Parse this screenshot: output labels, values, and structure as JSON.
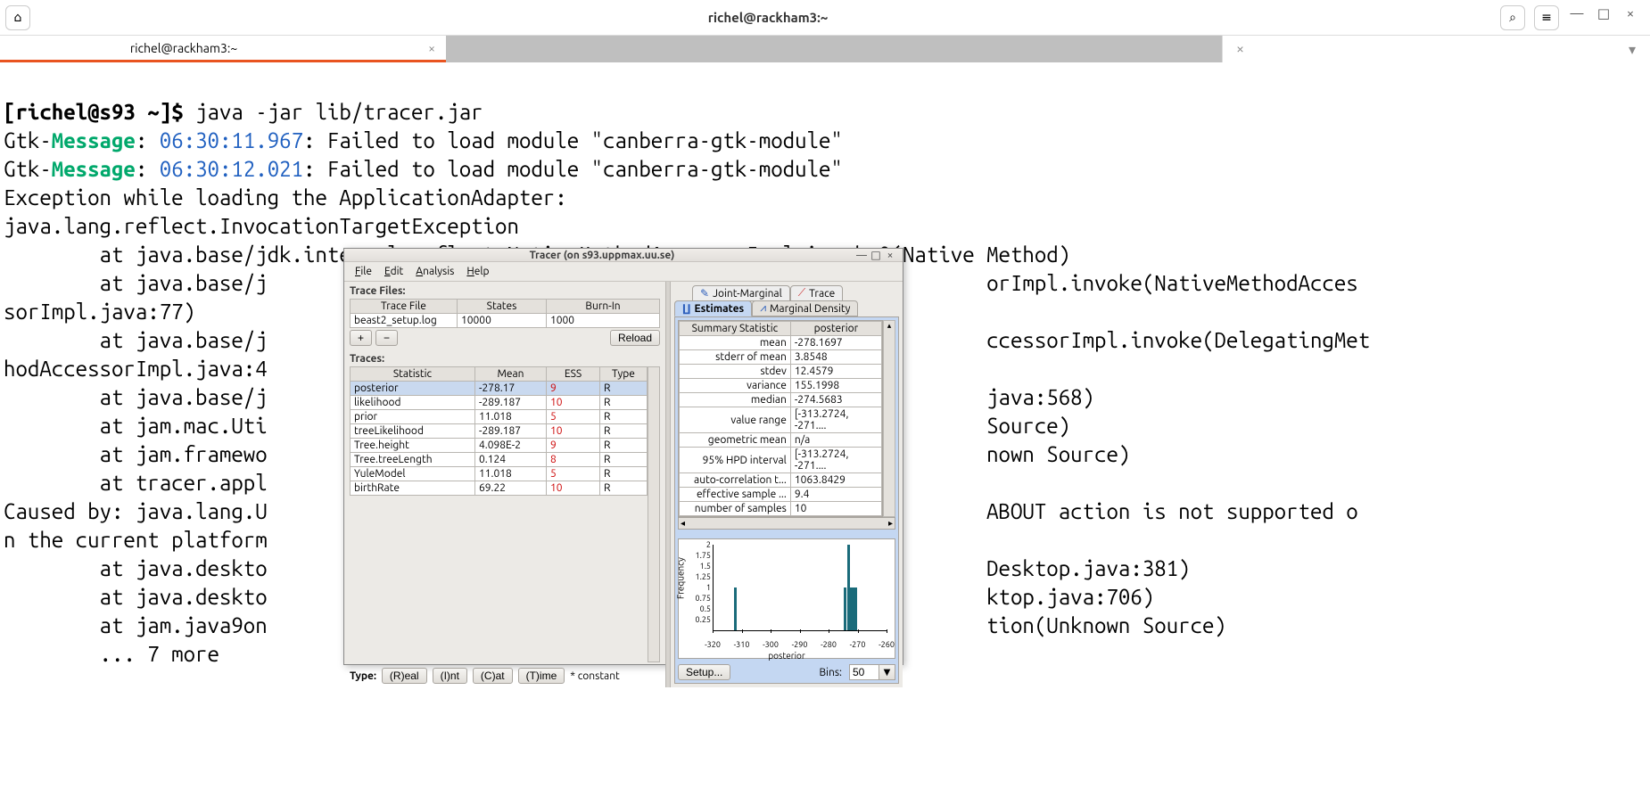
{
  "window": {
    "title": "richel@rackham3:~",
    "tab_title": "richel@rackham3:~"
  },
  "terminal": {
    "prompt": "[richel@s93 ~]$ ",
    "command": "java -jar lib/tracer.jar",
    "gtk_prefix": "Gtk-",
    "gtk_message": "Message",
    "gtk_colon": ": ",
    "ts1": "06:30:11.967",
    "ts2": "06:30:12.021",
    "gtk_tail": ": Failed to load module \"canberra-gtk-module\"",
    "line_exc": "Exception while loading the ApplicationAdapter:",
    "line_ite": "java.lang.reflect.InvocationTargetException",
    "trace1": "        at java.base/jdk.internal.reflect.NativeMethodAccessorImpl.invoke0(Native Method)",
    "trace2a": "        at java.base/j",
    "trace2b": "orImpl.invoke(NativeMethodAcces",
    "trace2c": "sorImpl.java:77)",
    "trace3a": "        at java.base/j",
    "trace3b": "ccessorImpl.invoke(DelegatingMet",
    "trace3c": "hodAccessorImpl.java:4",
    "trace4a": "        at java.base/j",
    "trace4b": "java:568)",
    "trace5a": "        at jam.mac.Uti",
    "trace5b": "Source)",
    "trace6a": "        at jam.framewo",
    "trace6b": "nown Source)",
    "trace7a": "        at tracer.appl",
    "caused_a": "Caused by: java.lang.U",
    "caused_b": "ABOUT action is not supported o",
    "caused_c": "n the current platform",
    "trace8a": "        at java.deskto",
    "trace8b": "Desktop.java:381)",
    "trace9a": "        at java.deskto",
    "trace9b": "ktop.java:706)",
    "trace10a": "        at jam.java9on",
    "trace10b": "tion(Unknown Source)",
    "more": "        ... 7 more"
  },
  "tracer": {
    "title": "Tracer (on s93.uppmax.uu.se)",
    "menu": {
      "file": "File",
      "edit": "Edit",
      "analysis": "Analysis",
      "help": "Help"
    },
    "trace_files_label": "Trace Files:",
    "tf_headers": {
      "file": "Trace File",
      "states": "States",
      "burnin": "Burn-In"
    },
    "tf_row": {
      "file": "beast2_setup.log",
      "states": "10000",
      "burnin": "1000"
    },
    "plus": "+",
    "minus": "−",
    "reload": "Reload",
    "traces_label": "Traces:",
    "tr_headers": {
      "stat": "Statistic",
      "mean": "Mean",
      "ess": "ESS",
      "type": "Type"
    },
    "tr_rows": [
      {
        "stat": "posterior",
        "mean": "-278.17",
        "ess": "9",
        "type": "R",
        "sel": true
      },
      {
        "stat": "likelihood",
        "mean": "-289.187",
        "ess": "10",
        "type": "R"
      },
      {
        "stat": "prior",
        "mean": "11.018",
        "ess": "5",
        "type": "R"
      },
      {
        "stat": "treeLikelihood",
        "mean": "-289.187",
        "ess": "10",
        "type": "R"
      },
      {
        "stat": "Tree.height",
        "mean": "4.098E-2",
        "ess": "9",
        "type": "R"
      },
      {
        "stat": "Tree.treeLength",
        "mean": "0.124",
        "ess": "8",
        "type": "R"
      },
      {
        "stat": "YuleModel",
        "mean": "11.018",
        "ess": "5",
        "type": "R"
      },
      {
        "stat": "birthRate",
        "mean": "69.22",
        "ess": "10",
        "type": "R"
      }
    ],
    "type_label": "Type:",
    "type_buttons": {
      "real": "(R)eal",
      "int": "(I)nt",
      "cat": "(C)at",
      "time": "(T)ime"
    },
    "constant": "* constant",
    "tabs": {
      "joint": "Joint-Marginal",
      "trace": "Trace",
      "estimates": "Estimates",
      "density": "Marginal Density"
    },
    "stat_headers": {
      "name": "Summary Statistic",
      "val": "posterior"
    },
    "stat_rows": [
      {
        "k": "mean",
        "v": "-278.1697"
      },
      {
        "k": "stderr of mean",
        "v": "3.8548"
      },
      {
        "k": "stdev",
        "v": "12.4579"
      },
      {
        "k": "variance",
        "v": "155.1998"
      },
      {
        "k": "median",
        "v": "-274.5683"
      },
      {
        "k": "value range",
        "v": "[-313.2724, -271...."
      },
      {
        "k": "geometric mean",
        "v": "n/a"
      },
      {
        "k": "95% HPD interval",
        "v": "[-313.2724, -271...."
      },
      {
        "k": "auto-correlation t...",
        "v": "1063.8429"
      },
      {
        "k": "effective sample ...",
        "v": "9.4"
      },
      {
        "k": "number of samples",
        "v": "10"
      }
    ],
    "setup": "Setup...",
    "bins_label": "Bins:",
    "bins_value": "50",
    "chart_ylabel": "Frequency",
    "chart_xlabel": "posterior"
  },
  "chart_data": {
    "type": "bar",
    "title": "",
    "xlabel": "posterior",
    "ylabel": "Frequency",
    "xlim": [
      -320,
      -260
    ],
    "ylim": [
      0,
      2
    ],
    "xticks": [
      -320,
      -310,
      -300,
      -290,
      -280,
      -270,
      -260
    ],
    "yticks": [
      0.25,
      0.5,
      0.75,
      1,
      1.25,
      1.5,
      1.75,
      2
    ],
    "bars": [
      {
        "x": -313,
        "y": 1
      },
      {
        "x": -275,
        "y": 1
      },
      {
        "x": -274,
        "y": 2
      },
      {
        "x": -273.5,
        "y": 1
      },
      {
        "x": -273,
        "y": 1
      },
      {
        "x": -272,
        "y": 1
      },
      {
        "x": -271.5,
        "y": 1
      }
    ]
  }
}
